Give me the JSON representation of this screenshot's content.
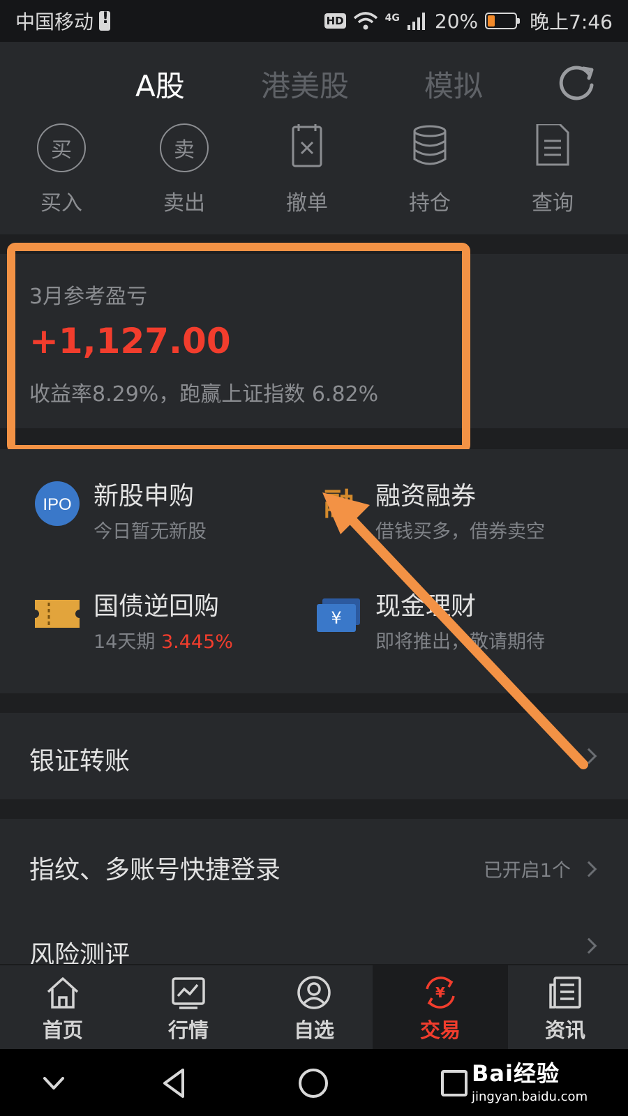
{
  "status_bar": {
    "carrier": "中国移动",
    "network": "4G",
    "hd_badge": "HD",
    "battery_percent": "20%",
    "time": "晚上7:46"
  },
  "top_tabs": [
    {
      "label": "A股",
      "active": true
    },
    {
      "label": "港美股",
      "active": false
    },
    {
      "label": "模拟",
      "active": false
    }
  ],
  "quick_actions": [
    {
      "label": "买入",
      "icon": "buy-icon",
      "glyph": "买"
    },
    {
      "label": "卖出",
      "icon": "sell-icon",
      "glyph": "卖"
    },
    {
      "label": "撤单",
      "icon": "cancel-order-icon"
    },
    {
      "label": "持仓",
      "icon": "holdings-icon"
    },
    {
      "label": "查询",
      "icon": "query-document-icon"
    }
  ],
  "pnl": {
    "title": "3月参考盈亏",
    "value": "+1,127.00",
    "subtitle": "收益率8.29%，跑赢上证指数 6.82%",
    "value_color": "#f23d2d"
  },
  "services": [
    {
      "title": "新股申购",
      "subtitle": "今日暂无新股",
      "icon": "ipo-icon",
      "icon_text": "IPO"
    },
    {
      "title": "融资融券",
      "subtitle": "借钱买多，借券卖空",
      "icon": "margin-trading-icon",
      "icon_text": "融"
    },
    {
      "title": "国债逆回购",
      "subtitle_prefix": "14天期 ",
      "subtitle_rate": "3.445%",
      "icon": "ticket-icon"
    },
    {
      "title": "现金理财",
      "subtitle": "即将推出，敬请期待",
      "icon": "cash-management-icon",
      "icon_text": "¥"
    }
  ],
  "list": {
    "bank_transfer": "银证转账",
    "quick_login": "指纹、多账号快捷登录",
    "quick_login_status": "已开启1个",
    "risk_assessment": "风险测评"
  },
  "bottom_nav": [
    {
      "label": "首页",
      "icon": "home-icon",
      "active": false
    },
    {
      "label": "行情",
      "icon": "market-chart-icon",
      "active": false
    },
    {
      "label": "自选",
      "icon": "watchlist-icon",
      "active": false
    },
    {
      "label": "交易",
      "icon": "trade-icon",
      "active": true
    },
    {
      "label": "资讯",
      "icon": "news-icon",
      "active": false
    }
  ],
  "watermark": {
    "brand": "Bai经验",
    "url": "jingyan.baidu.com"
  },
  "colors": {
    "accent_red": "#f23d2d",
    "highlight_orange": "#f39245",
    "panel_bg": "#27292c"
  }
}
